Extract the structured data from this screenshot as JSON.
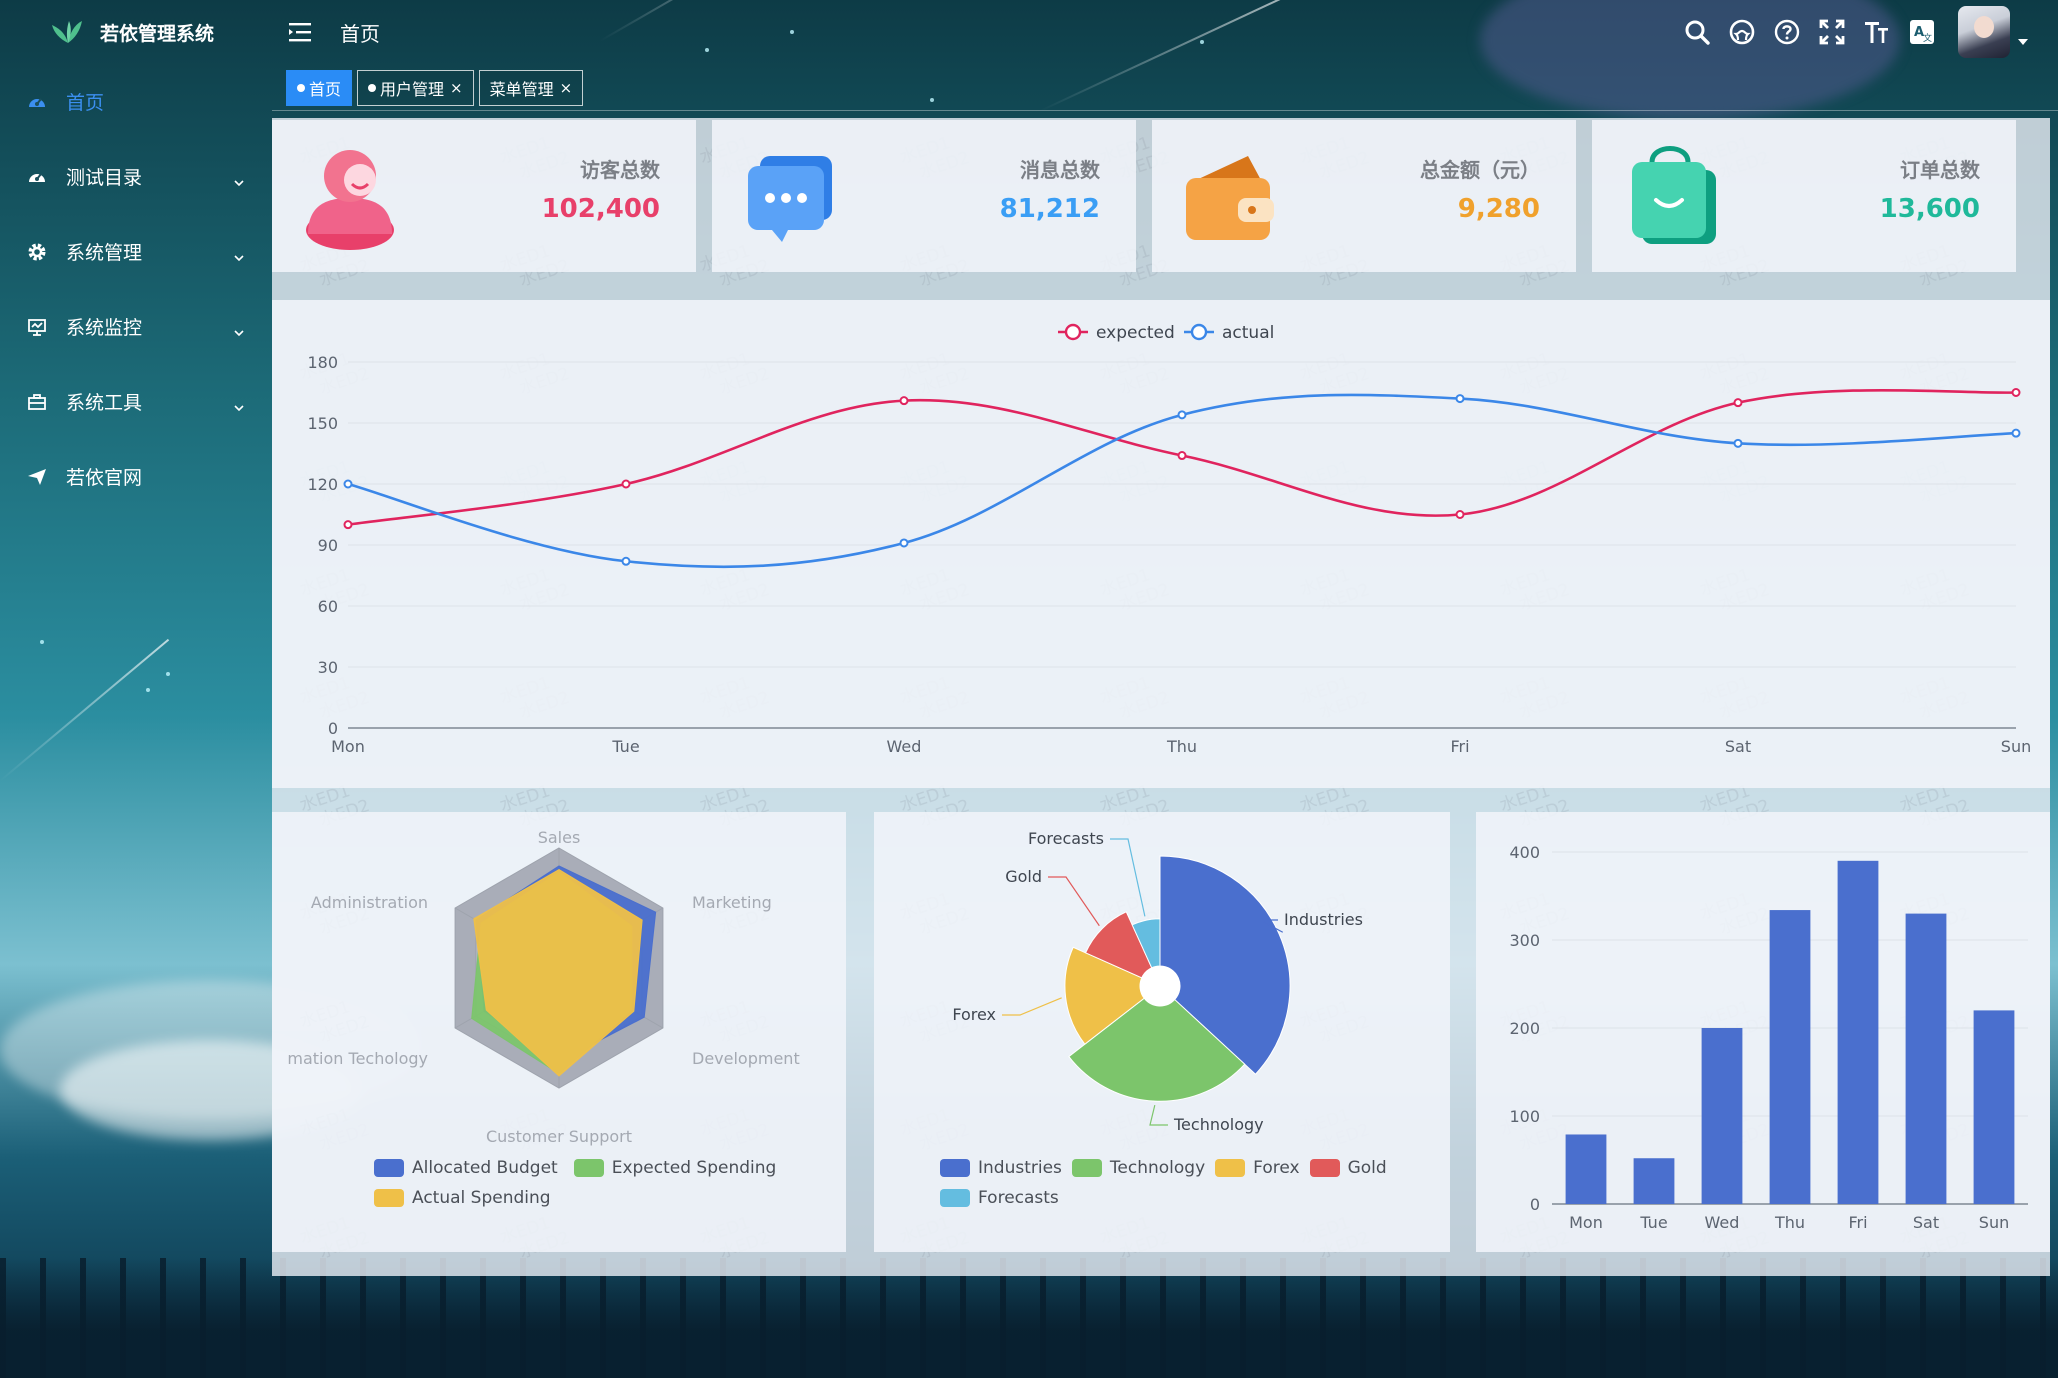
{
  "app": {
    "title": "若依管理系统"
  },
  "sidebar": {
    "items": [
      {
        "label": "首页",
        "icon": "dashboard-icon",
        "active": true,
        "expandable": false
      },
      {
        "label": "测试目录",
        "icon": "dashboard-icon",
        "active": false,
        "expandable": true
      },
      {
        "label": "系统管理",
        "icon": "gear-icon",
        "active": false,
        "expandable": true
      },
      {
        "label": "系统监控",
        "icon": "monitor-icon",
        "active": false,
        "expandable": true
      },
      {
        "label": "系统工具",
        "icon": "toolbox-icon",
        "active": false,
        "expandable": true
      },
      {
        "label": "若依官网",
        "icon": "paper-plane-icon",
        "active": false,
        "expandable": false
      }
    ]
  },
  "header": {
    "breadcrumb": "首页",
    "icons": [
      "search-icon",
      "github-icon",
      "help-icon",
      "fullscreen-icon",
      "font-size-icon",
      "translate-icon"
    ]
  },
  "tags": [
    {
      "label": "首页",
      "active": true,
      "closable": false
    },
    {
      "label": "用户管理",
      "active": false,
      "closable": true
    },
    {
      "label": "菜单管理",
      "active": false,
      "closable": true
    }
  ],
  "tag_close_glyph": "×",
  "watermark": {
    "line1": "水ED1",
    "line2": "水ED2"
  },
  "stats": [
    {
      "title": "访客总数",
      "value": "102,400",
      "color": "#e8406a",
      "icon": "user-icon"
    },
    {
      "title": "消息总数",
      "value": "81,212",
      "color": "#3a9ef5",
      "icon": "message-icon"
    },
    {
      "title": "总金额（元）",
      "value": "9,280",
      "color": "#f0a12c",
      "icon": "wallet-icon"
    },
    {
      "title": "订单总数",
      "value": "13,600",
      "color": "#1fb99a",
      "icon": "shopping-bag-icon"
    }
  ],
  "chart_data": [
    {
      "type": "line",
      "title": "",
      "x": [
        "Mon",
        "Tue",
        "Wed",
        "Thu",
        "Fri",
        "Sat",
        "Sun"
      ],
      "ylim": [
        0,
        180
      ],
      "yticks": [
        0,
        30,
        60,
        90,
        120,
        150,
        180
      ],
      "smooth": true,
      "grid": true,
      "legend": "top-center",
      "series": [
        {
          "name": "expected",
          "color": "#e0245e",
          "values": [
            100,
            120,
            161,
            134,
            105,
            160,
            165
          ]
        },
        {
          "name": "actual",
          "color": "#3b87e8",
          "values": [
            120,
            82,
            91,
            154,
            162,
            140,
            145
          ]
        }
      ]
    },
    {
      "type": "radar",
      "indicators": [
        "Sales",
        "Marketing",
        "Development",
        "Customer Support",
        "Information Techology",
        "Administration"
      ],
      "visible_indicator_labels": [
        "Sales",
        "Marketing",
        "Development",
        "Customer Support",
        "mation Techology",
        "Administration"
      ],
      "max": 100,
      "legend": "bottom",
      "series": [
        {
          "name": "Allocated Budget",
          "color": "#4a6fce",
          "values": [
            85,
            93,
            82,
            78,
            72,
            80
          ]
        },
        {
          "name": "Expected Spending",
          "color": "#7cc56b",
          "values": [
            80,
            70,
            70,
            88,
            84,
            75
          ]
        },
        {
          "name": "Actual Spending",
          "color": "#efc048",
          "values": [
            82,
            80,
            72,
            90,
            70,
            82
          ]
        }
      ]
    },
    {
      "type": "pie",
      "subtype": "nightingale-rose",
      "legend": "bottom",
      "slices": [
        {
          "name": "Industries",
          "value": 320,
          "color": "#4a6fce"
        },
        {
          "name": "Technology",
          "value": 240,
          "color": "#7cc56b"
        },
        {
          "name": "Forex",
          "value": 149,
          "color": "#efc048"
        },
        {
          "name": "Gold",
          "value": 100,
          "color": "#e15a5a"
        },
        {
          "name": "Forecasts",
          "value": 59,
          "color": "#64bde0"
        }
      ]
    },
    {
      "type": "bar",
      "categories": [
        "Mon",
        "Tue",
        "Wed",
        "Thu",
        "Fri",
        "Sat",
        "Sun"
      ],
      "values": [
        79,
        52,
        200,
        334,
        390,
        330,
        220
      ],
      "ylim": [
        0,
        400
      ],
      "yticks": [
        0,
        100,
        200,
        300,
        400
      ],
      "color": "#4a6fce",
      "grid": true
    }
  ]
}
